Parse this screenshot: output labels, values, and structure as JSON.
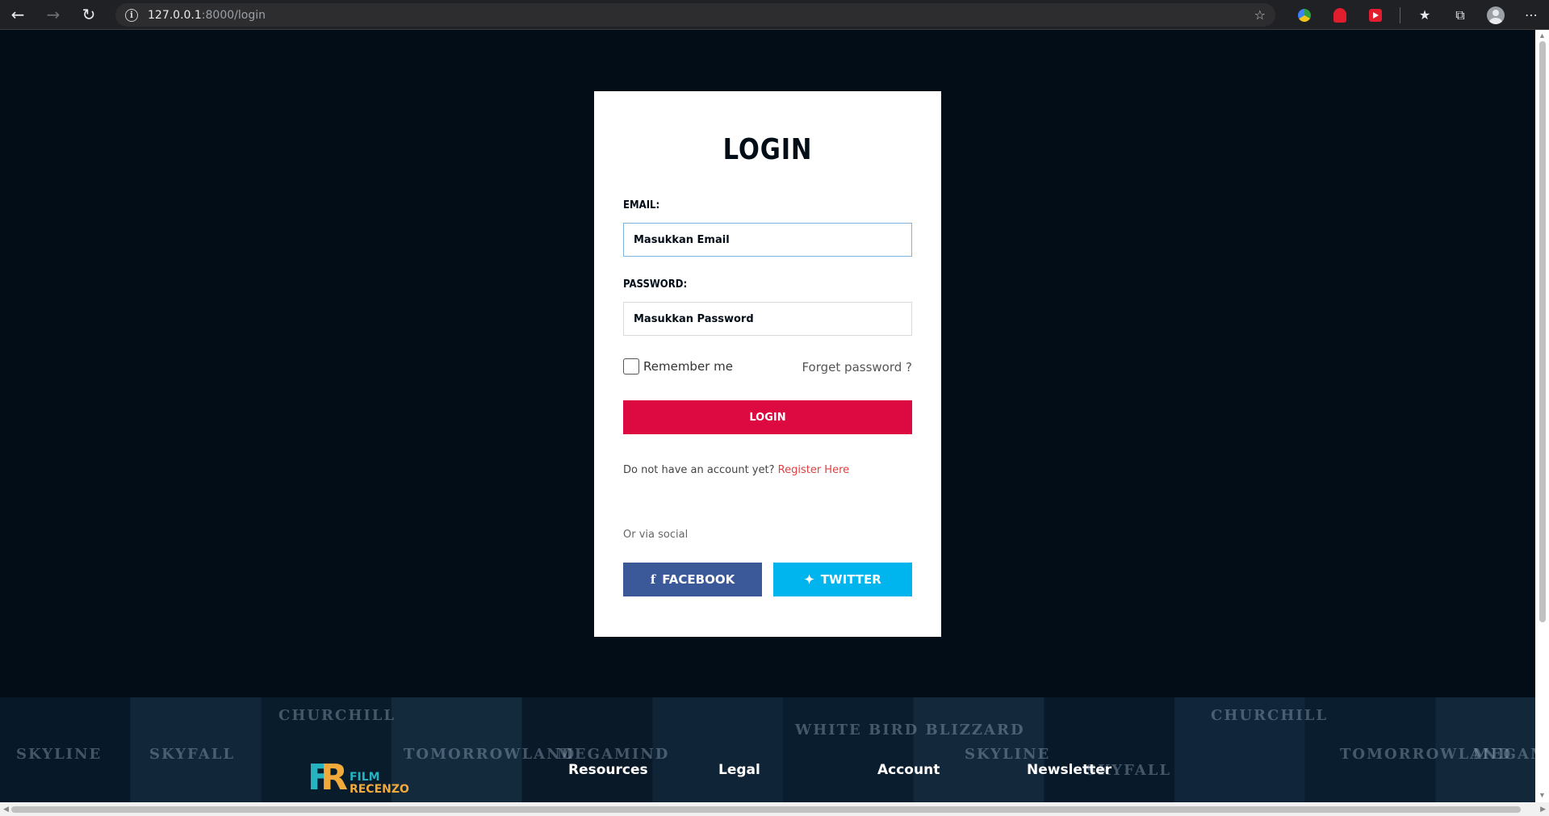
{
  "browser": {
    "url_host": "127.0.0.1",
    "url_path": ":8000/login"
  },
  "login": {
    "title": "LOGIN",
    "email_label": "EMAIL:",
    "email_placeholder": "Masukkan Email",
    "password_label": "PASSWORD:",
    "password_placeholder": "Masukkan Password",
    "remember_label": "Remember me",
    "forget_label": "Forget password ?",
    "submit_label": "LOGIN",
    "register_prompt": "Do not have an account yet?",
    "register_link": "Register Here",
    "social_prompt": "Or via social",
    "facebook_label": "FACEBOOK",
    "twitter_label": "TWITTER"
  },
  "footer": {
    "logo_word1": "FILM",
    "logo_word2": "RECENZO",
    "nav": [
      "Resources",
      "Legal",
      "Account",
      "Newsletter"
    ],
    "poster_titles": [
      "SKYLINE",
      "SKYFALL",
      "CHURCHILL",
      "TOMORROWLAND",
      "MEGAMIND",
      "WHITE BIRD BLIZZARD",
      "SKYLINE",
      "SKYFALL",
      "CHURCHILL",
      "TOMORROWLAND",
      "MEGAMIND"
    ]
  },
  "colors": {
    "background": "#020d18",
    "accent": "#dc0a40",
    "facebook": "#3b5998",
    "twitter": "#00b4ee",
    "link": "#e23e3e"
  }
}
